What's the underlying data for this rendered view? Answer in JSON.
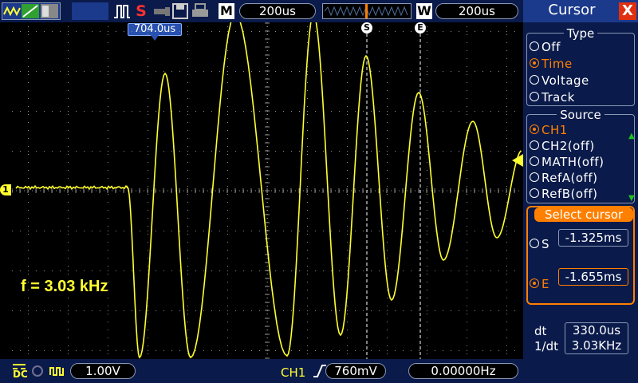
{
  "top_bar": {
    "stop_symbol": "S",
    "memory_label": "M",
    "timebase": "200us",
    "window_label": "W",
    "window_timebase": "200us",
    "trigger_position": "704.0us"
  },
  "waveform": {
    "channel_marker": "1",
    "cursor_s_marker": "S",
    "cursor_e_marker": "E",
    "measurement": "f = 3.03 kHz",
    "trace_color": "#ffff30",
    "grid_color": "#8f8f8f",
    "cursor_color": "#ffffff"
  },
  "bottom_bar": {
    "coupling": "DC",
    "ch1_scale": "1.00V",
    "trigger_source": "CH1",
    "trigger_level": "760mV",
    "frequency": "0.00000Hz"
  },
  "cursor_panel": {
    "title": "Cursor",
    "close_symbol": "X",
    "type_group": {
      "title": "Type",
      "options": [
        {
          "label": "Off",
          "selected": false
        },
        {
          "label": "Time",
          "selected": true
        },
        {
          "label": "Voltage",
          "selected": false
        },
        {
          "label": "Track",
          "selected": false
        }
      ]
    },
    "source_group": {
      "title": "Source",
      "options": [
        {
          "label": "CH1",
          "selected": true
        },
        {
          "label": "CH2(off)",
          "selected": false
        },
        {
          "label": "MATH(off)",
          "selected": false
        },
        {
          "label": "RefA(off)",
          "selected": false
        },
        {
          "label": "RefB(off)",
          "selected": false
        }
      ]
    },
    "select_cursor": {
      "title": "Select cursor",
      "s_label": "S",
      "s_value": "-1.325ms",
      "e_label": "E",
      "e_value": "-1.655ms"
    },
    "dt_label": "dt",
    "dt_value": "330.0us",
    "inv_dt_label": "1/dt",
    "inv_dt_value": "3.03KHz",
    "accent_color": "#ff8000"
  }
}
